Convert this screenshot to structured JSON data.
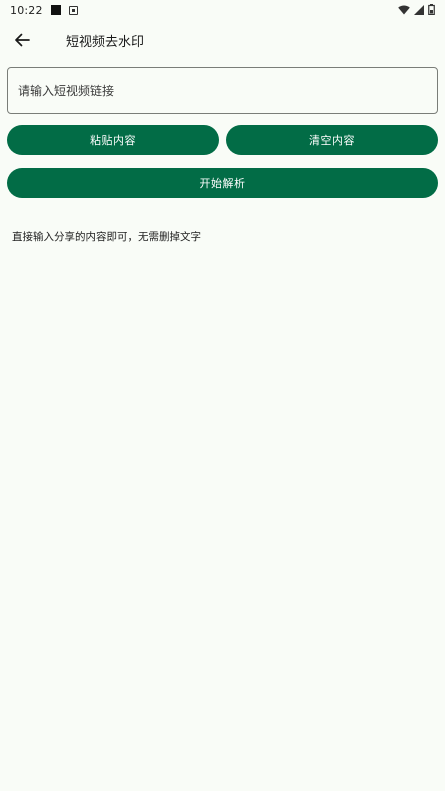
{
  "status_bar": {
    "time": "10:22",
    "icons": [
      "notification-square-icon",
      "app-notification-icon",
      "wifi-icon",
      "signal-icon",
      "battery-icon"
    ]
  },
  "app_bar": {
    "back_icon": "arrow-left-icon",
    "title": "短视频去水印"
  },
  "input": {
    "placeholder": "请输入短视频链接",
    "value": ""
  },
  "buttons": {
    "paste": "粘贴内容",
    "clear": "清空内容",
    "start": "开始解析"
  },
  "hint": "直接输入分享的内容即可，无需删掉文字",
  "colors": {
    "primary": "#026c46",
    "background": "#f9fcf7",
    "outline": "#7a7d78"
  }
}
